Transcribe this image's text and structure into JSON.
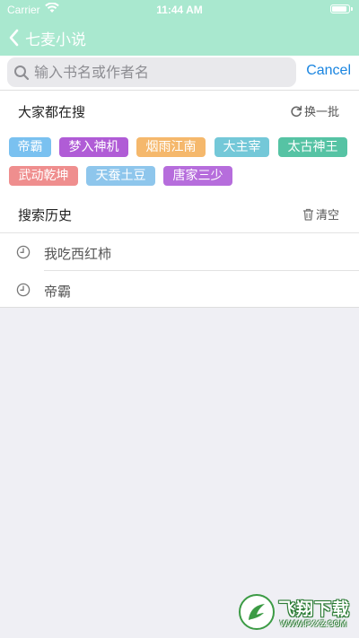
{
  "status_bar": {
    "carrier": "Carrier",
    "time": "11:44 AM"
  },
  "nav": {
    "back_label": "七麦小说"
  },
  "search": {
    "placeholder": "输入书名或作者名",
    "value": "",
    "cancel_label": "Cancel"
  },
  "hot": {
    "title": "大家都在搜",
    "refresh_label": "换一批",
    "tags": [
      {
        "label": "帝霸",
        "color": "#7ac1f0"
      },
      {
        "label": "梦入神机",
        "color": "#b05cd6"
      },
      {
        "label": "烟雨江南",
        "color": "#f5b86c"
      },
      {
        "label": "大主宰",
        "color": "#74c8d8"
      },
      {
        "label": "太古神王",
        "color": "#56c3a4"
      },
      {
        "label": "武动乾坤",
        "color": "#ef8e8e"
      },
      {
        "label": "天蚕土豆",
        "color": "#8ec6ec"
      },
      {
        "label": "唐家三少",
        "color": "#b66ddc"
      }
    ]
  },
  "history": {
    "title": "搜索历史",
    "clear_label": "清空",
    "items": [
      {
        "label": "我吃西红柿"
      },
      {
        "label": "帝霸"
      }
    ]
  },
  "theme": {
    "nav_bg": "#a9e8cf",
    "link_color": "#1a85e0"
  },
  "watermark": {
    "text": "飞翔下载",
    "url": "WWW.FXXZ.COM"
  }
}
